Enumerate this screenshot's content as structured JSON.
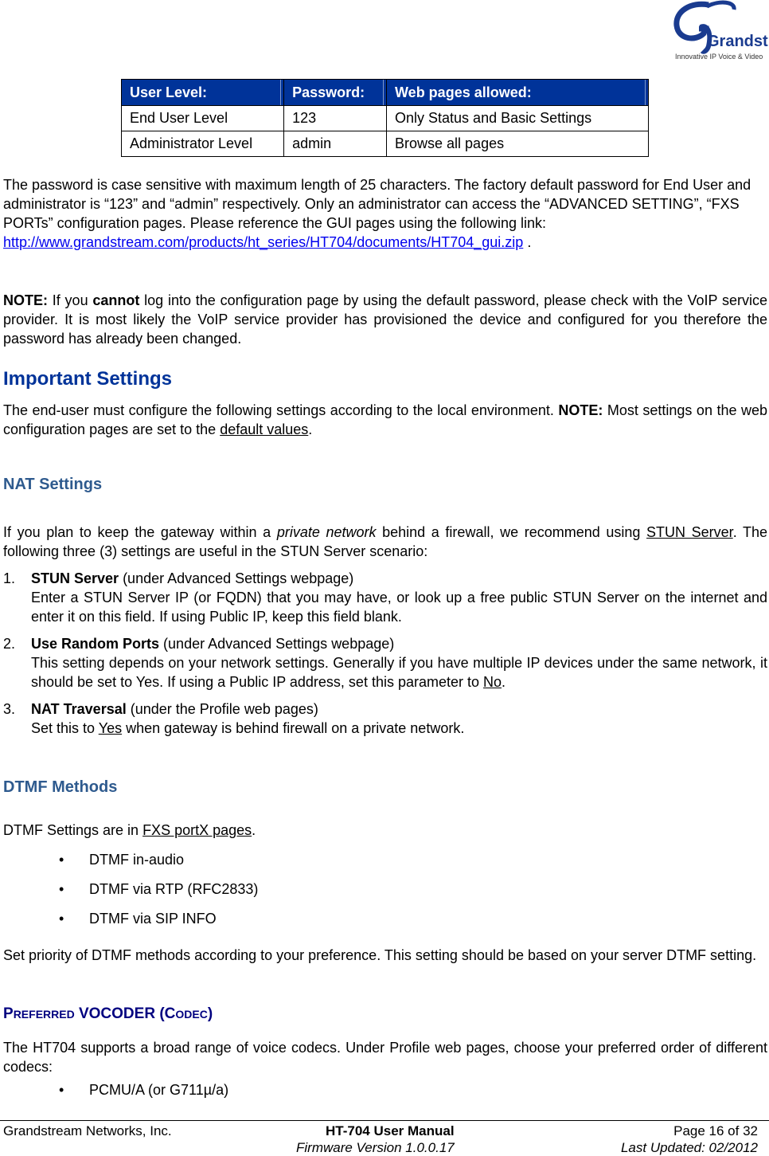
{
  "header": {
    "logo": {
      "icon": "grandstream-logo-icon",
      "brand": "Grandstream",
      "tagline": "Innovative IP Voice & Video"
    }
  },
  "user_levels_table": {
    "headers": [
      "User Level:",
      "Password:",
      "Web pages allowed:"
    ],
    "rows": [
      [
        "End User Level",
        "123",
        "Only Status and Basic Settings"
      ],
      [
        "Administrator Level",
        "admin",
        "Browse all pages"
      ]
    ]
  },
  "password_paragraph": {
    "text": "The password is case sensitive with maximum length of 25 characters. The factory default password for End User and administrator is “123” and “admin” respectively. Only an administrator can access the “ADVANCED SETTING”, “FXS PORTs” configuration pages.  Please reference the GUI pages using the following link:  ",
    "link": "http://www.grandstream.com/products/ht_series/HT704/documents/HT704_gui.zip",
    "suffix": " ."
  },
  "note_paragraph": {
    "label": "NOTE:",
    "pre": "  If you ",
    "bold": "cannot",
    "post": " log into the configuration page by using the default password, please check with the VoIP service provider.  It is most likely the VoIP service provider has provisioned the device and configured for you therefore the password has already been changed."
  },
  "important_settings": {
    "heading": "Important Settings",
    "text": "The end-user must configure the following settings according to the local environment.   ",
    "note_label": "NOTE:",
    "note_text": "  Most settings on the web configuration pages are set to the ",
    "link_text": "default values",
    "suffix": "."
  },
  "nat_settings": {
    "heading": "NAT Settings",
    "intro_pre": "If you plan to keep the gateway within a ",
    "intro_italic": "private network",
    "intro_mid": " behind a firewall, we recommend using ",
    "intro_link": "STUN Server",
    "intro_post": ". The following three (3) settings are useful in the STUN Server scenario:",
    "items": [
      {
        "num": "1.",
        "title": "STUN Server",
        "context": " (under Advanced Settings webpage)",
        "desc": "Enter a STUN Server IP (or FQDN) that you may have, or look up a free public STUN Server on the internet and enter it on this field. If using Public IP, keep this field blank."
      },
      {
        "num": "2.",
        "title": "Use Random Ports",
        "context": " (under Advanced Settings webpage)",
        "desc": "This setting depends on your network settings.  Generally if you have multiple IP devices under the same network, it should be set to Yes. If using a Public IP address, set this parameter to ",
        "desc_link": "No",
        "desc_suffix": "."
      },
      {
        "num": "3.",
        "title": "NAT Traversal",
        "context": " (under the Profile web pages)",
        "desc_pre": "Set this to ",
        "desc_link": "Yes",
        "desc": " when gateway is behind firewall on a private network."
      }
    ]
  },
  "dtmf_methods": {
    "heading": "DTMF Methods",
    "intro_pre": "DTMF Settings are in ",
    "intro_link": "FXS portX pages",
    "intro_post": ".",
    "bullet_icon": "bullet-icon",
    "bullet_char": "•",
    "items": [
      "DTMF in-audio",
      "DTMF via RTP (RFC2833)",
      "DTMF via SIP INFO"
    ],
    "priority_text": "Set priority of DTMF methods according to your preference. This setting should be based on your server DTMF setting."
  },
  "preferred_vocoder": {
    "heading_parts": [
      "P",
      "REFERRED",
      " VOCODER (C",
      "ODEC",
      ")"
    ],
    "text": "The HT704 supports a broad range of voice codecs.  Under Profile web pages, choose your preferred order of different codecs:",
    "items": [
      "PCMU/A (or G711µ/a)"
    ]
  },
  "footer": {
    "company": "Grandstream Networks, Inc.",
    "manual_title": "HT-704 User Manual",
    "firmware": "Firmware Version 1.0.0.17",
    "page": "Page 16 of 32",
    "updated": "Last Updated: 02/2012"
  },
  "colors": {
    "table_header_bg": "#003399",
    "heading_blue": "#003399",
    "section_heading": "#2E5A8E",
    "codec_heading": "#000080",
    "link": "#0000EE"
  }
}
